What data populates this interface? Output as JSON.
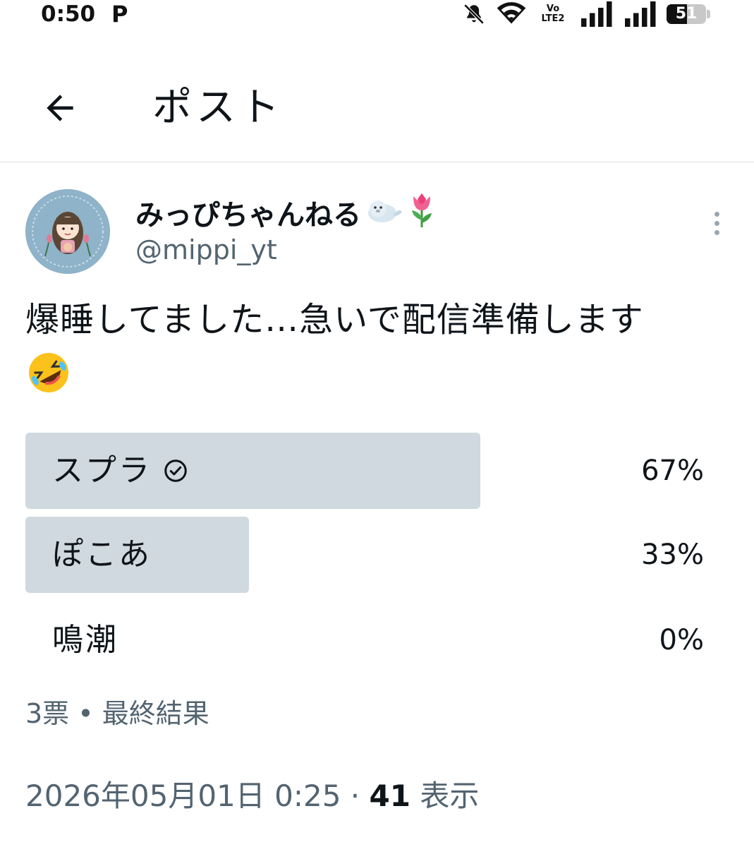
{
  "status_bar": {
    "time": "0:50",
    "app_indicator": "P",
    "network_label": "Vo LTE2",
    "battery_level": "51",
    "battery_fraction": 0.51,
    "icons": [
      "bell-muted-icon",
      "wifi-icon",
      "volte-icon",
      "signal-icon",
      "signal-icon",
      "battery-icon"
    ]
  },
  "header": {
    "title": "ポスト",
    "back_icon": "arrow-left-icon"
  },
  "author": {
    "display_name": "みっぴちゃんねる",
    "name_emoji": [
      "seal-emoji",
      "tulip-emoji"
    ],
    "handle": "@mippi_yt",
    "more_icon": "more-vertical-icon"
  },
  "post": {
    "text": "爆睡してました…急いで配信準備します",
    "emoji": "rolling-on-the-floor-laughing-emoji"
  },
  "poll": {
    "options": [
      {
        "label": "スプラ",
        "percent": "67%",
        "value": 0.67,
        "winner": true
      },
      {
        "label": "ぽこあ",
        "percent": "33%",
        "value": 0.33,
        "winner": false
      },
      {
        "label": "鳴潮",
        "percent": "0%",
        "value": 0.0,
        "winner": false
      }
    ],
    "summary": "3票 • 最終結果"
  },
  "meta": {
    "timestamp": "2026年05月01日 0:25 ·",
    "view_count": "41",
    "view_label": "表示"
  },
  "colors": {
    "text": "#0f1419",
    "secondary": "#536471",
    "poll_bar": "#cfd9df",
    "divider": "#dde3e8"
  }
}
